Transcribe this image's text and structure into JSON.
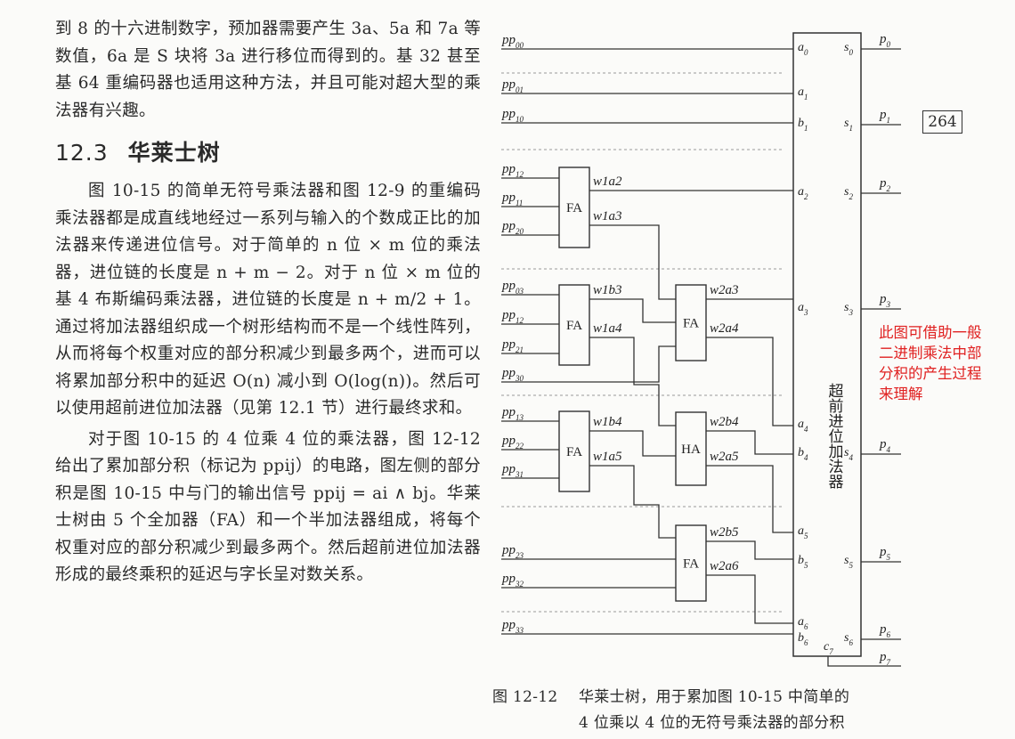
{
  "body_text": {
    "para1": "到 8 的十六进制数字，预加器需要产生 3a、5a 和 7a 等数值，6a 是 S 块将 3a 进行移位而得到的。基 32 甚至基 64 重编码器也适用这种方法，并且可能对超大型的乘法器有兴趣。",
    "section_number": "12.3",
    "section_title": "华莱士树",
    "para2": "图 10-15 的简单无符号乘法器和图 12-9 的重编码乘法器都是成直线地经过一系列与输入的个数成正比的加法器来传递进位信号。对于简单的 n 位 × m 位的乘法器，进位链的长度是 n + m − 2。对于 n 位 × m 位的基 4 布斯编码乘法器，进位链的长度是 n + m/2 + 1。通过将加法器组织成一个树形结构而不是一个线性阵列，从而将每个权重对应的部分积减少到最多两个，进而可以将累加部分积中的延迟 O(n) 减小到 O(log(n))。然后可以使用超前进位加法器（见第 12.1 节）进行最终求和。",
    "para3": "对于图 10-15 的 4 位乘 4 位的乘法器，图 12-12 给出了累加部分积（标记为 ppij）的电路，图左侧的部分积是图 10-15 中与门的输出信号 ppij = ai ∧ bj。华莱士树由 5 个全加器（FA）和一个半加法器组成，将每个权重对应的部分积减少到最多两个。然后超前进位加法器形成的最终乘积的延迟与字长呈对数关系。"
  },
  "figure": {
    "inputs": [
      {
        "base": "pp",
        "sub": "00"
      },
      {
        "base": "pp",
        "sub": "01"
      },
      {
        "base": "pp",
        "sub": "10"
      },
      {
        "base": "pp",
        "sub": "12"
      },
      {
        "base": "pp",
        "sub": "11"
      },
      {
        "base": "pp",
        "sub": "20"
      },
      {
        "base": "pp",
        "sub": "03"
      },
      {
        "base": "pp",
        "sub": "12"
      },
      {
        "base": "pp",
        "sub": "21"
      },
      {
        "base": "pp",
        "sub": "30"
      },
      {
        "base": "pp",
        "sub": "13"
      },
      {
        "base": "pp",
        "sub": "22"
      },
      {
        "base": "pp",
        "sub": "31"
      },
      {
        "base": "pp",
        "sub": "23"
      },
      {
        "base": "pp",
        "sub": "32"
      },
      {
        "base": "pp",
        "sub": "33"
      }
    ],
    "adders": [
      {
        "label": "FA",
        "outputs": [
          "w1a2",
          "w1a3"
        ]
      },
      {
        "label": "FA",
        "outputs": [
          "w1b3",
          "w1a4"
        ]
      },
      {
        "label": "FA",
        "outputs": [
          "w1b4",
          "w1a5"
        ]
      },
      {
        "label": "FA",
        "outputs": [
          "w2a3",
          "w2a4"
        ]
      },
      {
        "label": "HA",
        "outputs": [
          "w2b4",
          "w2a5"
        ]
      },
      {
        "label": "FA",
        "outputs": [
          "w2b5",
          "w2a6"
        ]
      }
    ],
    "cla_label": "超前进位加法器",
    "cla_inputs": [
      {
        "base": "a",
        "sub": "0"
      },
      {
        "base": "a",
        "sub": "1"
      },
      {
        "base": "b",
        "sub": "1"
      },
      {
        "base": "a",
        "sub": "2"
      },
      {
        "base": "a",
        "sub": "3"
      },
      {
        "base": "a",
        "sub": "4"
      },
      {
        "base": "b",
        "sub": "4"
      },
      {
        "base": "a",
        "sub": "5"
      },
      {
        "base": "b",
        "sub": "5"
      },
      {
        "base": "a",
        "sub": "6"
      },
      {
        "base": "b",
        "sub": "6"
      },
      {
        "base": "c",
        "sub": "7"
      }
    ],
    "cla_sums": [
      {
        "base": "s",
        "sub": "0"
      },
      {
        "base": "s",
        "sub": "1"
      },
      {
        "base": "s",
        "sub": "2"
      },
      {
        "base": "s",
        "sub": "3"
      },
      {
        "base": "s",
        "sub": "4"
      },
      {
        "base": "s",
        "sub": "5"
      },
      {
        "base": "s",
        "sub": "6"
      }
    ],
    "products": [
      {
        "base": "p",
        "sub": "0"
      },
      {
        "base": "p",
        "sub": "1"
      },
      {
        "base": "p",
        "sub": "2"
      },
      {
        "base": "p",
        "sub": "3"
      },
      {
        "base": "p",
        "sub": "4"
      },
      {
        "base": "p",
        "sub": "5"
      },
      {
        "base": "p",
        "sub": "6"
      },
      {
        "base": "p",
        "sub": "7"
      }
    ]
  },
  "caption": {
    "label": "图 12-12",
    "line1": "华莱士树，用于累加图 10-15 中简单的",
    "line2": "4 位乘以 4 位的无符号乘法器的部分积"
  },
  "page_number": "264",
  "margin_note": "此图可借助一般二进制乘法中部分积的产生过程来理解",
  "colors": {
    "note": "#e02020",
    "ink": "#222222",
    "paper": "#fbfbf9"
  }
}
